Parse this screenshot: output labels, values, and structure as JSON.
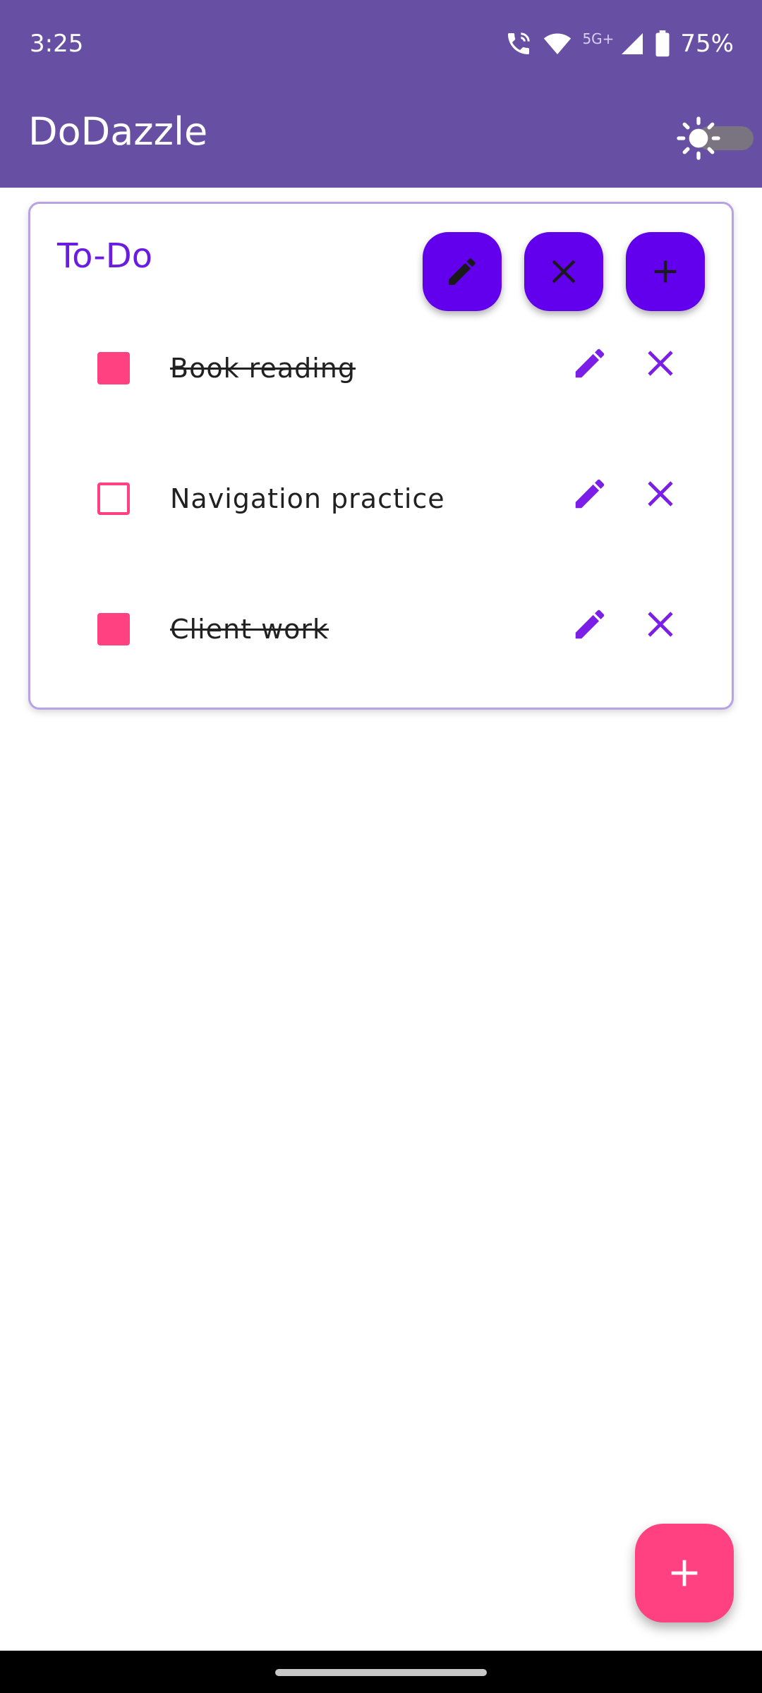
{
  "status_bar": {
    "time": "3:25",
    "network": "5G+",
    "battery": "75%"
  },
  "app_bar": {
    "title": "DoDazzle",
    "theme_toggle_icon": "sun-icon"
  },
  "card": {
    "title": "To-Do",
    "actions": [
      {
        "name": "edit-list-button",
        "icon": "pencil-icon"
      },
      {
        "name": "delete-list-button",
        "icon": "close-icon"
      },
      {
        "name": "add-item-button",
        "icon": "plus-icon"
      }
    ],
    "items": [
      {
        "label": "Book reading",
        "checked": true
      },
      {
        "label": "Navigation practice",
        "checked": false
      },
      {
        "label": "Client work",
        "checked": true
      }
    ]
  },
  "fab": {
    "icon": "plus-icon"
  },
  "colors": {
    "app_bar": "#6750A4",
    "accent": "#6200EE",
    "checkbox": "#FF4081",
    "fab": "#FF4081",
    "title": "#6A1DE0"
  }
}
